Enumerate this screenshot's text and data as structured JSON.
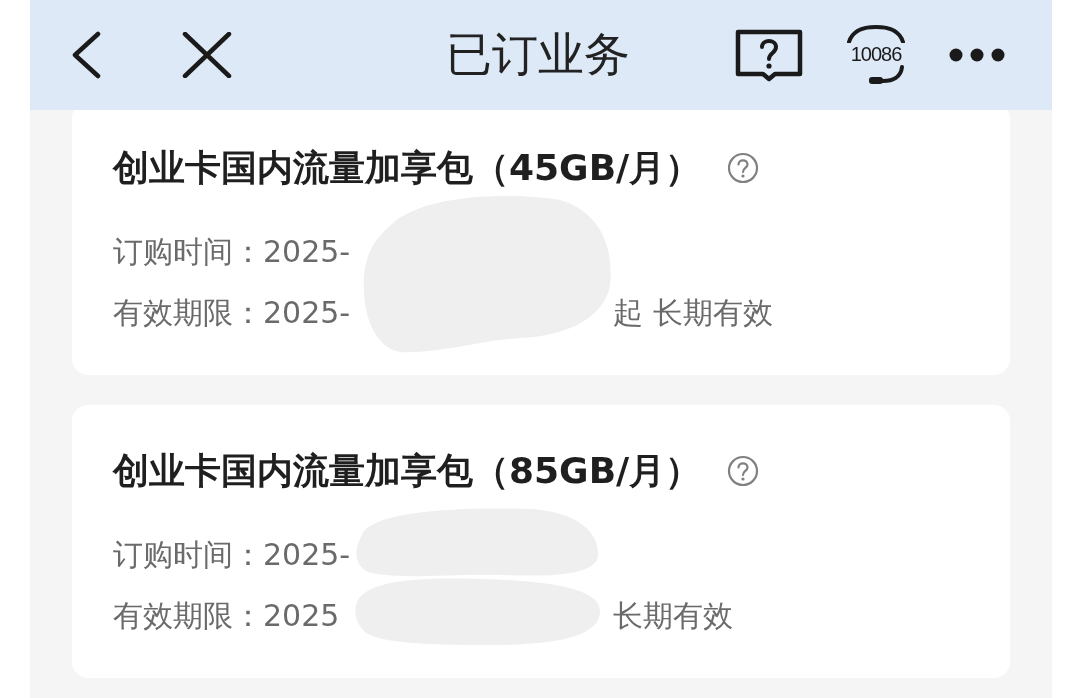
{
  "header": {
    "title": "已订业务",
    "hotline": "10086"
  },
  "packages": [
    {
      "title": "创业卡国内流量加享包（45GB/月）",
      "redacted": true,
      "details": [
        {
          "label": "订购时间：",
          "value": "2025-"
        },
        {
          "label": "有效期限：",
          "value": "2025-",
          "suffix": "起 长期有效"
        }
      ]
    },
    {
      "title": "创业卡国内流量加享包（85GB/月）",
      "redacted": true,
      "details": [
        {
          "label": "订购时间：",
          "value": "2025-"
        },
        {
          "label": "有效期限：",
          "value": "2025",
          "suffix": "长期有效"
        }
      ]
    }
  ]
}
